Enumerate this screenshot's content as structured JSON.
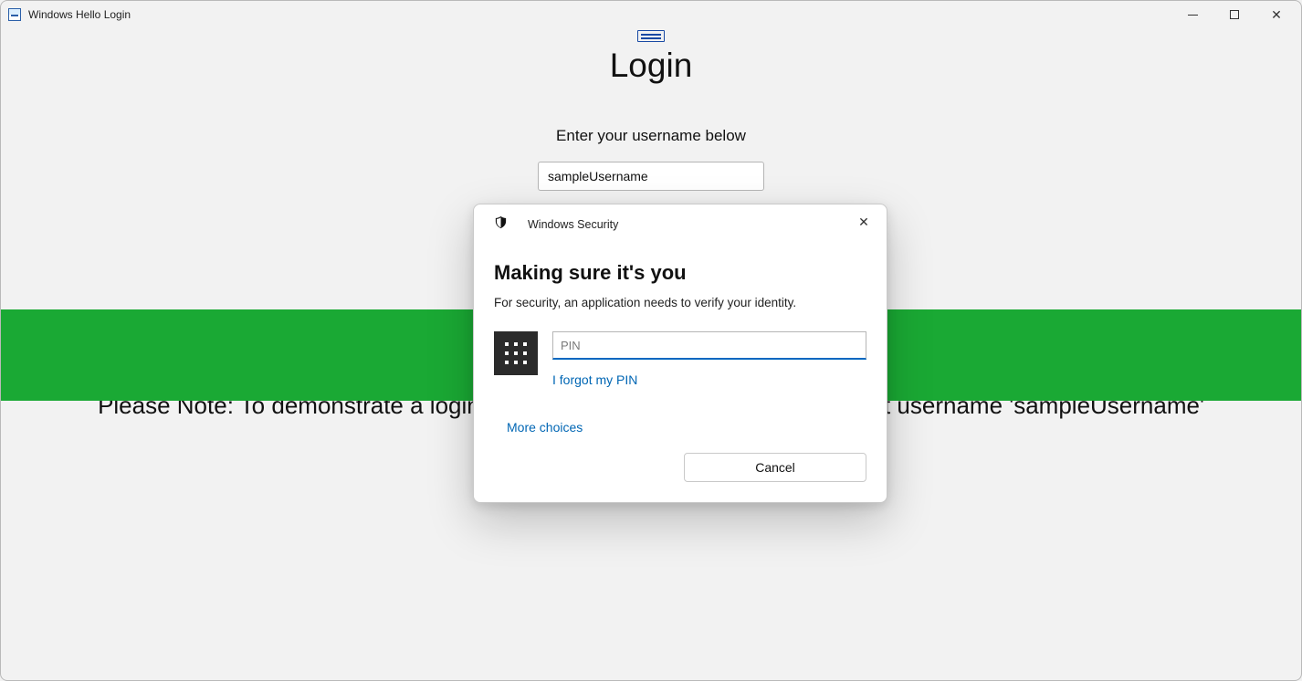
{
  "window": {
    "title": "Windows Hello Login"
  },
  "page": {
    "heading": "Login",
    "prompt": "Enter your username below",
    "username_value": "sampleUsername",
    "note": "Please Note: To demonstrate a login to the fabricated service, please select username 'sampleUsername'"
  },
  "dialog": {
    "app_name": "Windows Security",
    "title": "Making sure it's you",
    "subtitle": "For security, an application needs to verify your identity.",
    "pin_placeholder": "PIN",
    "forgot_label": "I forgot my PIN",
    "more_choices_label": "More choices",
    "cancel_label": "Cancel"
  }
}
